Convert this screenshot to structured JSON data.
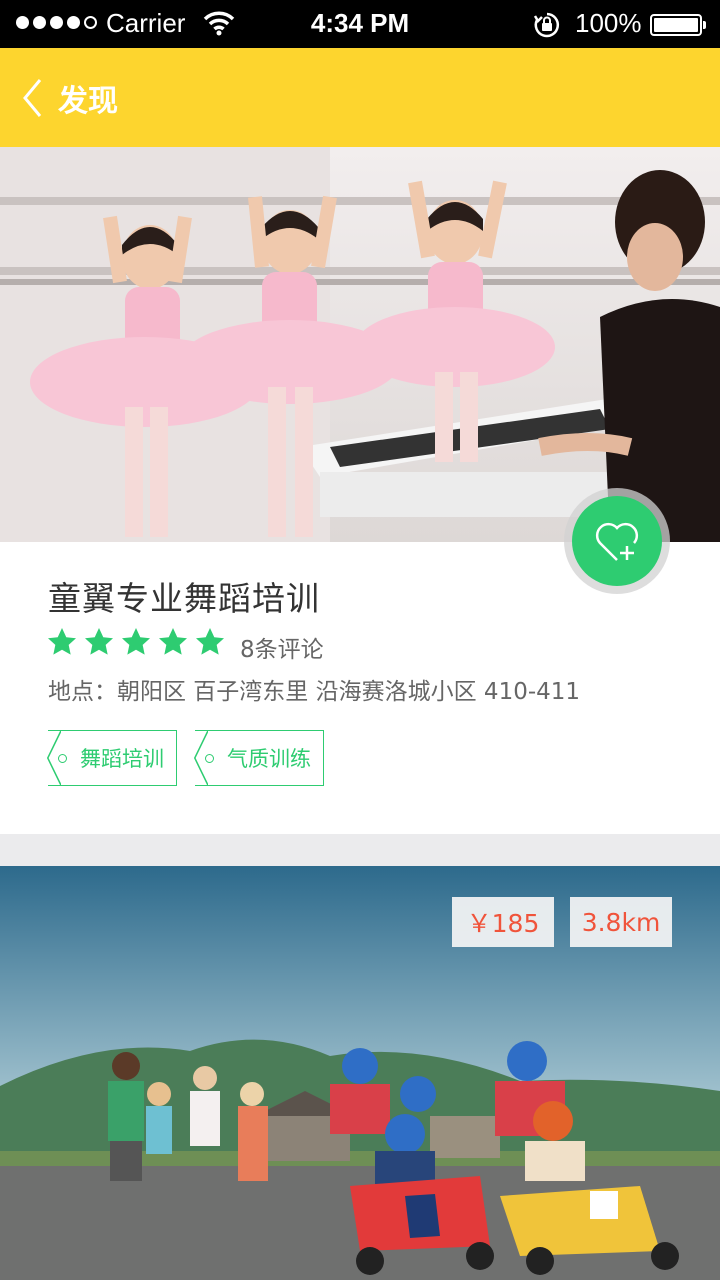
{
  "status_bar": {
    "carrier": "Carrier",
    "time": "4:34 PM",
    "battery": "100%",
    "signal_bars": 4,
    "signal_total": 5
  },
  "nav": {
    "back_label": "发现",
    "accent_color": "#fdd52e"
  },
  "listing": {
    "title": "童翼专业舞蹈培训",
    "rating": 5,
    "reviews": "8条评论",
    "address": "地点：朝阳区 百子湾东里 沿海赛洛城小区 410-411",
    "tags": [
      "舞蹈培训",
      "气质训练"
    ],
    "favorite_icon": "heart-plus-icon",
    "brand_color": "#2ecc71"
  },
  "second_listing": {
    "price": "￥185",
    "distance": "3.8km",
    "price_color": "#f0543b"
  }
}
